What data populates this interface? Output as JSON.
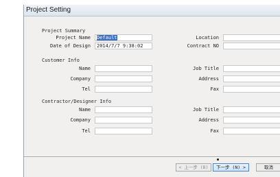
{
  "window": {
    "title": "Project Setting"
  },
  "summary": {
    "heading": "Project Summary",
    "project_name_label": "Project Name",
    "project_name_value": "Default",
    "date_label": "Date of Design",
    "date_value": "2014/7/7 9:38:02",
    "location_label": "Location",
    "location_value": "",
    "contract_label": "Contract NO",
    "contract_value": ""
  },
  "customer": {
    "heading": "Customer Info",
    "name_label": "Name",
    "company_label": "Company",
    "tel_label": "Tel",
    "job_title_label": "Job Title",
    "address_label": "Address",
    "fax_label": "Fax",
    "name_value": "",
    "company_value": "",
    "tel_value": "",
    "job_title_value": "",
    "address_value": "",
    "fax_value": ""
  },
  "contractor": {
    "heading": "Contractor/Designer Info",
    "name_label": "Name",
    "company_label": "Company",
    "tel_label": "Tel",
    "job_title_label": "Job Title",
    "address_label": "Address",
    "fax_label": "Fax",
    "name_value": "",
    "company_value": "",
    "tel_value": "",
    "job_title_value": "",
    "address_value": "",
    "fax_value": ""
  },
  "buttons": {
    "back": "< 上一步 (B)",
    "next": "下一步 (N) >",
    "cancel": "取消"
  }
}
